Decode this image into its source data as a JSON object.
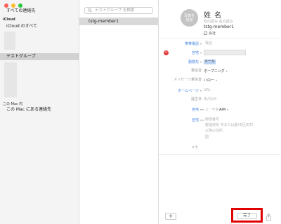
{
  "sidebar": {
    "all_contacts": "すべての連絡先",
    "icloud_header": "iCloud",
    "icloud_all": "iCloud のすべて",
    "selected_group": "テストグループ",
    "on_mac_header": "この Mac 内",
    "on_mac_all": "この Mac にある連絡先"
  },
  "list": {
    "search_placeholder": "テストグループ を検索",
    "rows": [
      "tstg-member1"
    ]
  },
  "detail": {
    "photo_label_1": "写真を",
    "photo_label_2": "追加",
    "name_title": "姓 名",
    "name_phonetic": "姓の読み 名の読み",
    "name_main": "tstg-member1",
    "company_label": "会社",
    "fields": {
      "mobile_label": "携帯電話",
      "mobile_value": "電話",
      "home_label": "自宅",
      "work_label": "勤務先",
      "work_value": "メール",
      "ringtone_label": "着信音",
      "ringtone_value": "オープニング",
      "msg_label": "メッセージ着信音",
      "msg_value": "ハロー",
      "homepage_label": "ホームページ",
      "homepage_value": "URL",
      "birthday_label": "誕生日",
      "birthday_value": "年/月/日",
      "im_label": "自宅",
      "im_value_placeholder": "ユーザ名",
      "im_service": "AIM",
      "address_label": "自宅",
      "address_line1": "郵便番号",
      "address_line2": "都道府県 市または郡/市区町村",
      "address_line3": "以降の住所",
      "address_line4": "国",
      "memo_label": "メモ"
    },
    "add_button": "+",
    "done_button": "完了"
  },
  "colors": {
    "accent_blue": "#3a7ee0",
    "highlight_red": "#e00000",
    "delete_red": "#e23a3a"
  }
}
